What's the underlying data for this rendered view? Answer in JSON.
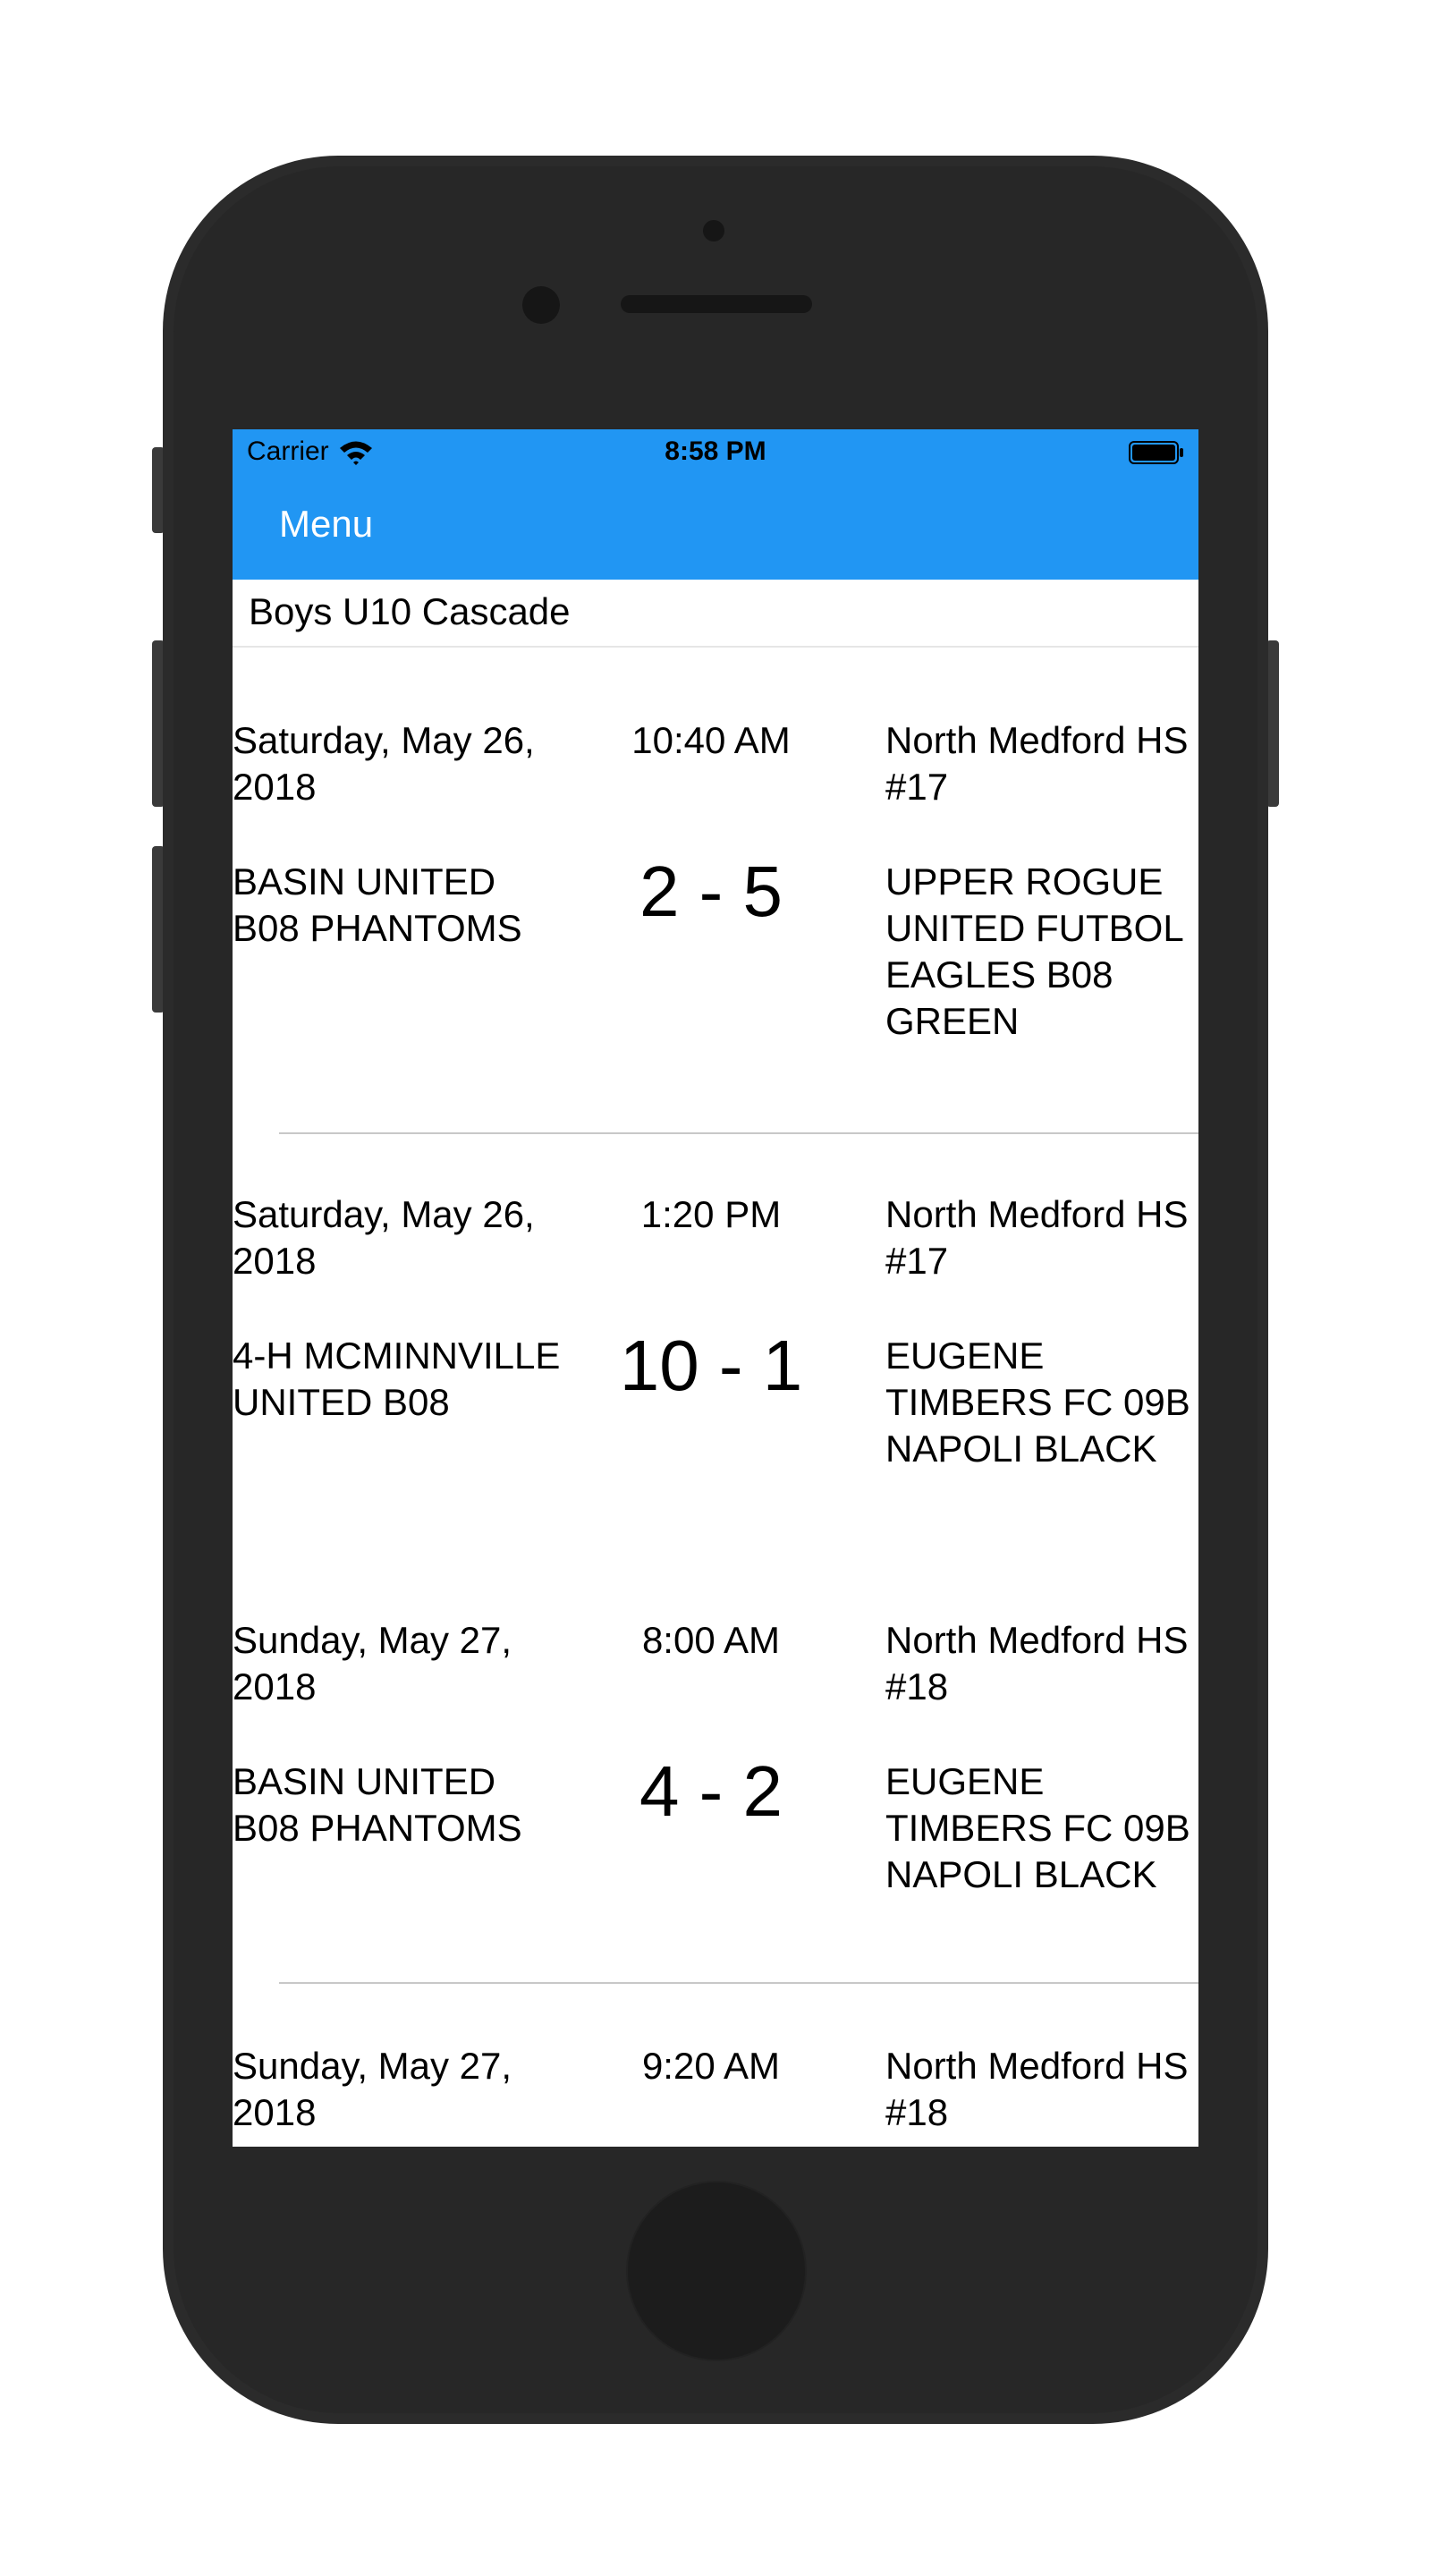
{
  "status_bar": {
    "carrier": "Carrier",
    "time": "8:58 PM",
    "color": "#2196F3"
  },
  "nav": {
    "menu_label": "Menu"
  },
  "picker": {
    "selected": "Boys U10 Cascade"
  },
  "matches": [
    {
      "date": "Saturday, May 26, 2018",
      "time": "10:40 AM",
      "location": "North Medford HS #17",
      "home_team": "BASIN UNITED B08 PHANTOMS",
      "score": "2 - 5",
      "away_team": "UPPER ROGUE UNITED FUTBOL EAGLES B08 GREEN"
    },
    {
      "date": "Saturday, May 26, 2018",
      "time": "1:20 PM",
      "location": "North Medford HS #17",
      "home_team": "4-H MCMINNVILLE UNITED B08",
      "score": "10 - 1",
      "away_team": "EUGENE TIMBERS FC 09B NAPOLI BLACK"
    },
    {
      "date": "Sunday, May 27, 2018",
      "time": "8:00 AM",
      "location": "North Medford HS #18",
      "home_team": "BASIN UNITED B08 PHANTOMS",
      "score": "4 - 2",
      "away_team": "EUGENE TIMBERS FC 09B NAPOLI BLACK"
    },
    {
      "date": "Sunday, May 27, 2018",
      "time": "9:20 AM",
      "location": "North Medford HS #18"
    }
  ]
}
